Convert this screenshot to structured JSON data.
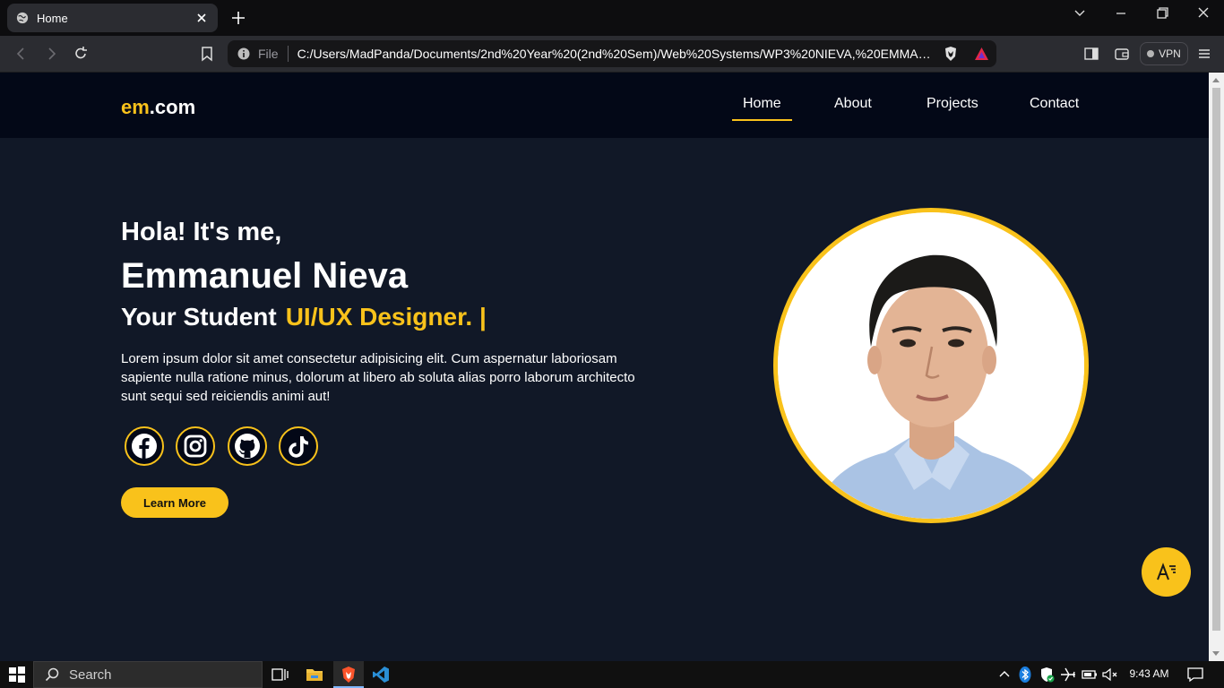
{
  "browser": {
    "tab_title": "Home",
    "url_scheme": "File",
    "url": "C:/Users/MadPanda/Documents/2nd%20Year%20(2nd%20Sem)/Web%20Systems/WP3%20NIEVA,%20EMMANU...",
    "vpn_label": "VPN"
  },
  "site": {
    "logo_accent": "em",
    "logo_rest": ".com",
    "nav": [
      "Home",
      "About",
      "Projects",
      "Contact"
    ],
    "active_nav": "Home"
  },
  "hero": {
    "greeting": "Hola! It's me,",
    "name": "Emmanuel Nieva",
    "role_prefix": "Your Student",
    "role_accent": "UI/UX Designer. |",
    "description": "Lorem ipsum dolor sit amet consectetur adipisicing elit. Cum aspernatur laboriosam sapiente nulla ratione minus, dolorum at libero ab soluta alias porro laborum architecto sunt sequi sed reiciendis animi aut!",
    "socials": [
      "facebook-icon",
      "instagram-icon",
      "github-icon",
      "tiktok-icon"
    ],
    "cta_label": "Learn More"
  },
  "taskbar": {
    "search_placeholder": "Search",
    "clock": "9:43 AM"
  },
  "colors": {
    "accent": "#f9c21b",
    "page_bg": "#111827",
    "header_bg": "#030817"
  }
}
